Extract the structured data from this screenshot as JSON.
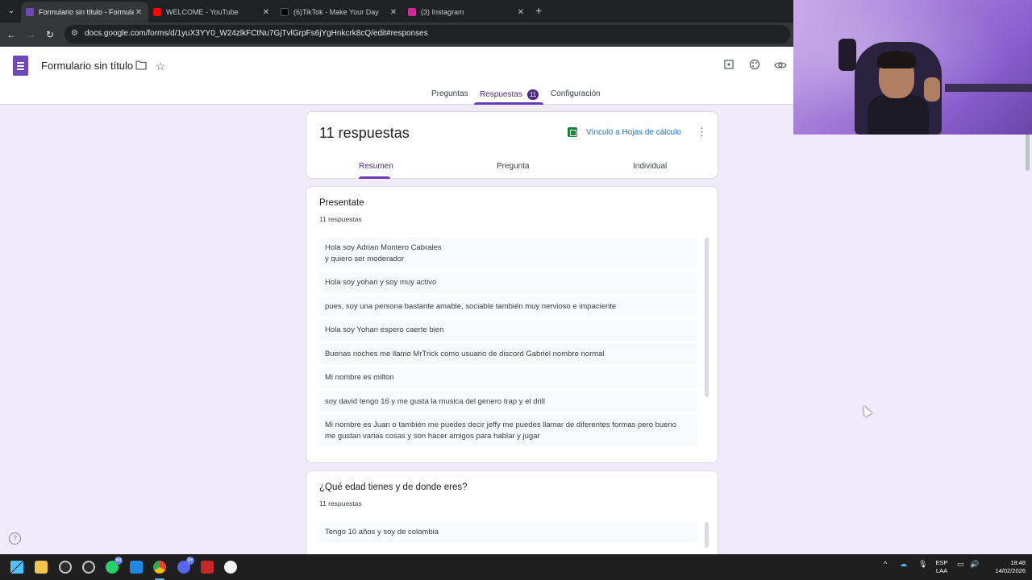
{
  "browser": {
    "tabs": [
      {
        "title": "Formulario sin título - Formula",
        "favicon_color": "#7248b9",
        "active": true
      },
      {
        "title": "WELCOME - YouTube",
        "favicon_color": "#ff0000",
        "active": false
      },
      {
        "title": "(6)TikTok - Make Your Day",
        "favicon_color": "#000000",
        "active": false
      },
      {
        "title": "(3) Instagram",
        "favicon_color": "#d6249f",
        "active": false
      }
    ],
    "tab_close": "✕",
    "new_tab": "+",
    "url": "docs.google.com/forms/d/1yuX3YY0_W24zlkFCtNu7GjTvlGrpFs6jYgHnkcrk8cQ/edit#responses"
  },
  "form": {
    "title": "Formulario sin título",
    "tabs": {
      "questions": "Preguntas",
      "responses": "Respuestas",
      "responses_count": "11",
      "settings": "Configuración"
    }
  },
  "summary": {
    "responses_title": "11 respuestas",
    "sheets_link": "Vínculo a Hojas de cálculo",
    "more": "⋮",
    "subtabs": {
      "summary": "Resumen",
      "question": "Pregunta",
      "individual": "Individual"
    }
  },
  "questions": [
    {
      "title": "Presentate",
      "count": "11 respuestas",
      "responses": [
        "Hola soy Adrian Montero Cabrales\ny quiero ser moderador",
        "Hola soy yohan y soy muy activo",
        "pues, soy una persona bastante amable, sociable también muy nervioso e impaciente",
        "Hola soy Yohan espero caerte bien",
        "Buenas noches me llamo MrTrick como usuario de discord Gabriel nombre normal",
        "Mi nombre es milton",
        "soy david tengo 16 y me gusta la musica del genero trap y el drill",
        "Mi nombre es Juan o también me puedes decir jeffy me puedes llamar de diferentes formas pero bueno\nme gustan varias cosas y son hacer amigos para hablar y jugar"
      ]
    },
    {
      "title": "¿Qué edad tienes y de donde eres?",
      "count": "11 respuestas",
      "responses": [
        "Tengo 10 años y soy de colombia"
      ]
    }
  ],
  "help": "?",
  "taskbar": {
    "whatsapp_badge": "68",
    "discord_badge": "9+",
    "lang": "ESP",
    "layout": "LAA",
    "time": "18:48",
    "date": "14/02/2026"
  },
  "colors": {
    "accent": "#673ab7",
    "accent_dark": "#4b2a8a",
    "link": "#1a73e8",
    "background": "#f0ebf8"
  }
}
